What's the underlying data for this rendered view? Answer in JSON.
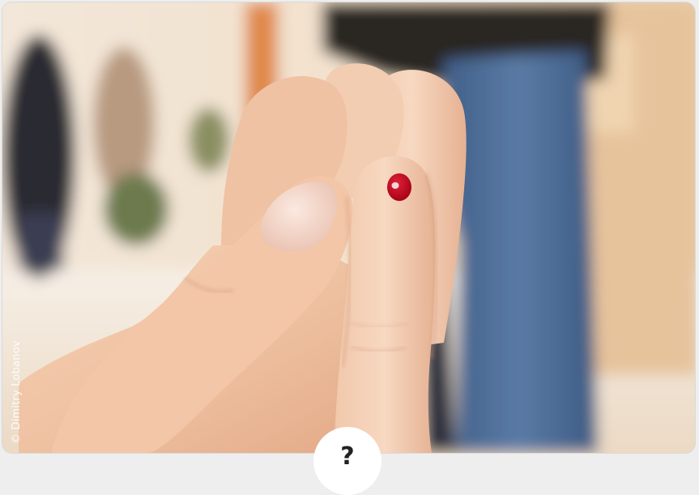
{
  "photo": {
    "subject": "hand-with-blood-drop-on-fingertip",
    "credit": "© Dimitry Lobanov"
  },
  "badge": {
    "label": "?"
  },
  "colors": {
    "background": "#eeeeee",
    "skin": "#f0c6a8",
    "blood": "#c4001a",
    "jeans": "#4f6f9a"
  }
}
